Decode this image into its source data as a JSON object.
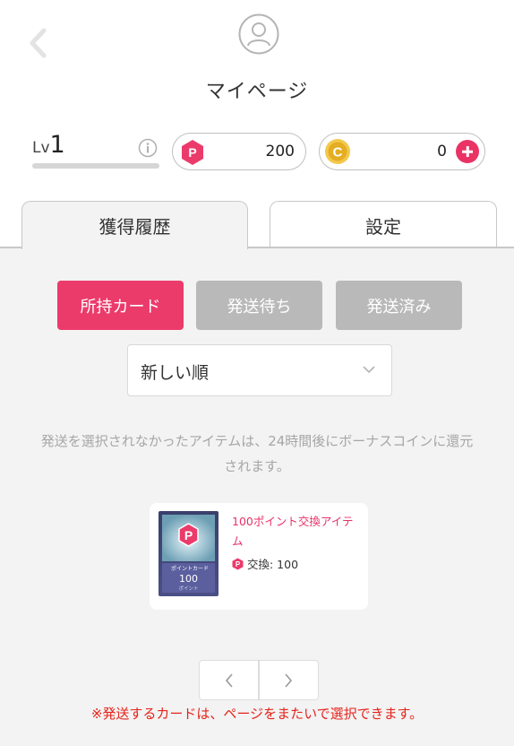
{
  "header": {
    "title": "マイページ",
    "back_icon": "chevron-left-icon",
    "avatar_icon": "user-avatar-icon"
  },
  "level": {
    "prefix": "Lv",
    "value": "1",
    "progress": 0
  },
  "wallet": {
    "points": "200",
    "points_icon_letter": "P",
    "coins": "0",
    "coins_icon_letter": "C"
  },
  "tabs": [
    {
      "label": "獲得履歴",
      "active": true
    },
    {
      "label": "設定",
      "active": false
    }
  ],
  "filters": [
    {
      "label": "所持カード",
      "active": true
    },
    {
      "label": "発送待ち",
      "active": false
    },
    {
      "label": "発送済み",
      "active": false
    }
  ],
  "sort": {
    "selected": "新しい順"
  },
  "notice": "発送を選択されなかったアイテムは、24時間後にボーナスコインに還元されます。",
  "items": [
    {
      "name": "100ポイント交換アイテム",
      "cost_label": "交換: 100",
      "thumb": {
        "letter": "P",
        "card_label": "ポイントカード",
        "amount": "100",
        "unit": "ポイント"
      }
    }
  ],
  "warning": "※発送するカードは、ページをまたいで選択できます。",
  "colors": {
    "accent": "#eb3b6b",
    "coin": "#e9b528",
    "warning": "#e5231b",
    "disabled": "#b9b9b9"
  }
}
